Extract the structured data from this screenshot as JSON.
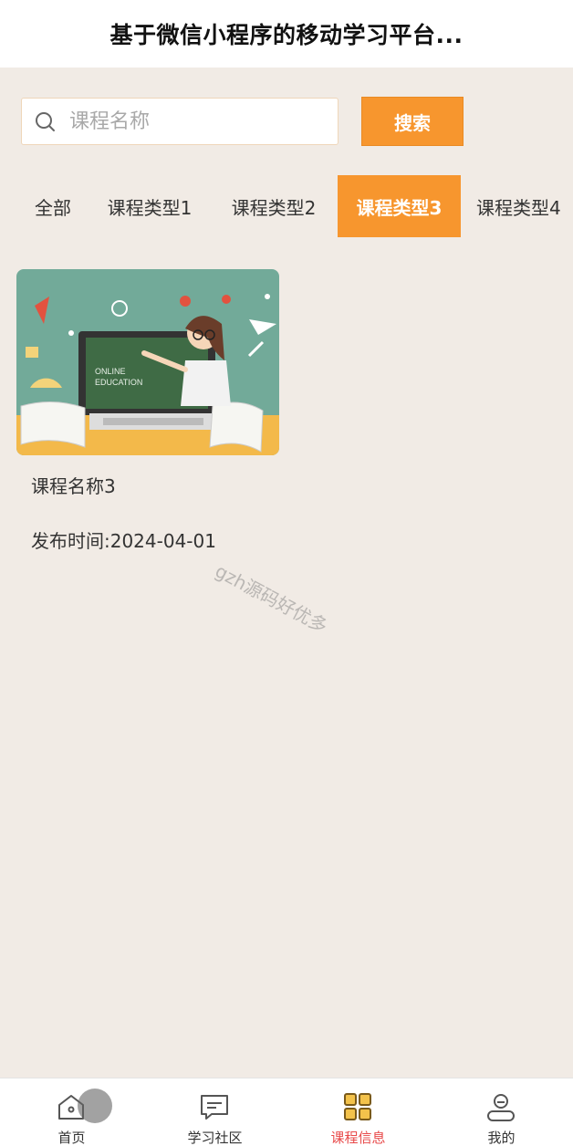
{
  "header": {
    "title": "基于微信小程序的移动学习平台..."
  },
  "search": {
    "placeholder": "课程名称",
    "value": "",
    "button_label": "搜索"
  },
  "tabs": [
    {
      "label": "全部"
    },
    {
      "label": "课程类型1"
    },
    {
      "label": "课程类型2"
    },
    {
      "label": "课程类型3",
      "active": true
    },
    {
      "label": "课程类型4"
    }
  ],
  "courses": [
    {
      "name": "课程名称3",
      "date_label": "发布时间:2024-04-01",
      "image_text_1": "ONLINE",
      "image_text_2": "EDUCATION"
    }
  ],
  "watermark": "gzh源码好优多",
  "tabbar": [
    {
      "label": "首页",
      "icon": "home-icon"
    },
    {
      "label": "学习社区",
      "icon": "chat-icon"
    },
    {
      "label": "课程信息",
      "icon": "grid-icon",
      "active": true
    },
    {
      "label": "我的",
      "icon": "user-icon"
    }
  ],
  "colors": {
    "accent": "#f7962e",
    "active_tab_text": "#e84a4a",
    "background": "#f1ebe5"
  }
}
